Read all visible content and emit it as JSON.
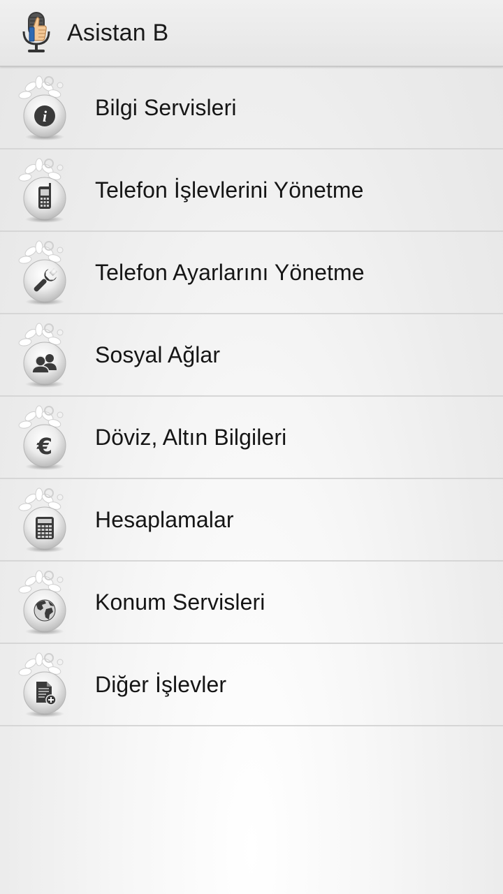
{
  "app": {
    "title": "Asistan B",
    "icon": "microphone-thumbs-up-icon"
  },
  "menu": {
    "items": [
      {
        "label": "Bilgi Servisleri",
        "icon": "info-icon"
      },
      {
        "label": "Telefon İşlevlerini Yönetme",
        "icon": "mobile-phone-icon"
      },
      {
        "label": "Telefon Ayarlarını Yönetme",
        "icon": "wrench-icon"
      },
      {
        "label": "Sosyal Ağlar",
        "icon": "users-icon"
      },
      {
        "label": "Döviz, Altın Bilgileri",
        "icon": "euro-icon"
      },
      {
        "label": "Hesaplamalar",
        "icon": "calculator-icon"
      },
      {
        "label": "Konum Servisleri",
        "icon": "globe-icon"
      },
      {
        "label": "Diğer İşlevler",
        "icon": "document-add-icon"
      }
    ]
  },
  "colors": {
    "header_bg": "#e8e8e8",
    "divider": "#d6d6d6",
    "icon_dark": "#3a3a3a",
    "text": "#151515"
  }
}
